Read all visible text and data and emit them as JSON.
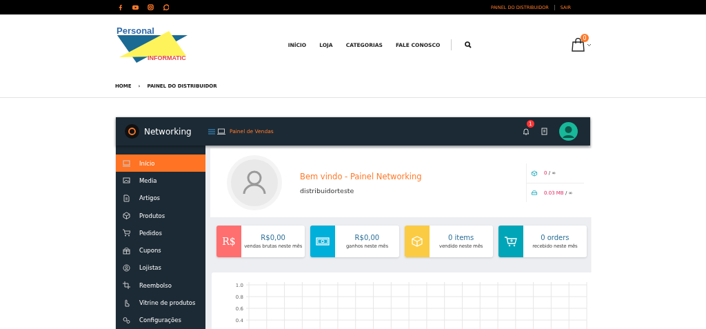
{
  "topbar": {
    "links": [
      "PAINEL DO DISTRIBUIDOR",
      "SAIR"
    ]
  },
  "header": {
    "logo": {
      "word1": "Personal",
      "word2": "INFORMATIC"
    },
    "nav": [
      "INÍCIO",
      "LOJA",
      "CATEGORIAS",
      "FALE CONOSCO"
    ],
    "cart_count": "0"
  },
  "breadcrumb": [
    "HOME",
    "›",
    "PAINEL DO DISTRIBUIDOR"
  ],
  "dashboard": {
    "brand": "Networking",
    "section": "Painel de Vendas",
    "notifications": "1",
    "sidebar": [
      {
        "label": "Início",
        "selected": true
      },
      {
        "label": "Media",
        "selected": false
      },
      {
        "label": "Artigos",
        "selected": false
      },
      {
        "label": "Produtos",
        "selected": false
      },
      {
        "label": "Pedidos",
        "selected": false
      },
      {
        "label": "Cupons",
        "selected": false
      },
      {
        "label": "Lojistas",
        "selected": false
      },
      {
        "label": "Reembolso",
        "selected": false
      },
      {
        "label": "Vitrine de produtos",
        "selected": false
      },
      {
        "label": "Configurações",
        "selected": false
      }
    ],
    "welcome": {
      "title": "Bem vindo - Painel Networking",
      "username": "distribuidorteste"
    },
    "limits": [
      {
        "value": "0",
        "sep": "/ ∞"
      },
      {
        "value": "0.03 MB",
        "sep": "/ ∞"
      }
    ],
    "stats": [
      {
        "kind": "text",
        "icon_text": "R$",
        "color": "#ff6f6f",
        "value": "R$0,00",
        "caption": "vendas brutas neste mês"
      },
      {
        "kind": "money",
        "color": "#00b0da",
        "value": "R$0,00",
        "caption": "ganhos neste mês"
      },
      {
        "kind": "box",
        "color": "#fbcb43",
        "value": "0 items",
        "caption": "vendido neste mês"
      },
      {
        "kind": "cart",
        "color": "#00a5b8",
        "value": "0 orders",
        "caption": "recebido neste mês"
      }
    ],
    "chart_y_labels": [
      "1.0",
      "0.8",
      "0.6",
      "0.4"
    ]
  }
}
